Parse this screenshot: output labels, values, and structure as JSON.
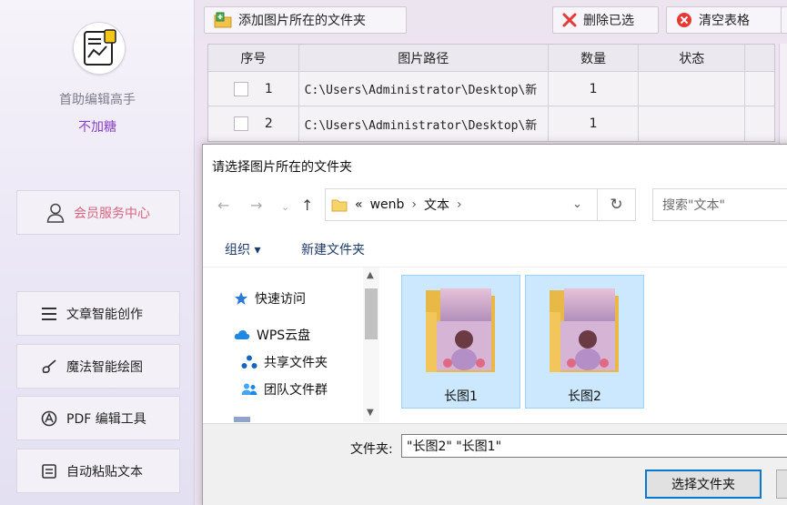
{
  "sidebar": {
    "app_name": "首助编辑高手",
    "app_sub": "不加糖",
    "member_label": "会员服务中心",
    "items": [
      {
        "label": "文章智能创作",
        "icon": "list-icon"
      },
      {
        "label": "魔法智能绘图",
        "icon": "brush-icon"
      },
      {
        "label": "PDF 编辑工具",
        "icon": "pdf-icon"
      },
      {
        "label": "自动粘贴文本",
        "icon": "clipboard-icon"
      }
    ]
  },
  "toolbar": {
    "add_label": "添加图片所在的文件夹",
    "delete_label": "删除已选",
    "clear_label": "清空表格"
  },
  "table": {
    "headers": [
      "序号",
      "图片路径",
      "数量",
      "状态"
    ],
    "rows": [
      {
        "index": "1",
        "path": "C:\\Users\\Administrator\\Desktop\\新",
        "count": "1",
        "status": ""
      },
      {
        "index": "2",
        "path": "C:\\Users\\Administrator\\Desktop\\新",
        "count": "1",
        "status": ""
      }
    ]
  },
  "dialog": {
    "title": "请选择图片所在的文件夹",
    "breadcrumb_prefix": "«",
    "breadcrumb": [
      "wenb",
      "文本"
    ],
    "search_placeholder": "搜索\"文本\"",
    "organize_label": "组织 ▾",
    "new_folder_label": "新建文件夹",
    "nav_items": [
      {
        "label": "快速访问",
        "icon": "star-icon"
      },
      {
        "label": "WPS云盘",
        "icon": "cloud-icon"
      },
      {
        "label": "共享文件夹",
        "icon": "share-icon"
      },
      {
        "label": "团队文件群",
        "icon": "team-icon"
      }
    ],
    "files": [
      {
        "name": "长图1"
      },
      {
        "name": "长图2"
      }
    ],
    "folder_label": "文件夹:",
    "folder_value": "\"长图2\" \"长图1\"",
    "select_button": "选择文件夹"
  },
  "colors": {
    "accent_purple": "#8a3fc8",
    "member_pink": "#d9627f",
    "selection_blue": "#cce8ff",
    "focus_blue": "#0078d7"
  }
}
